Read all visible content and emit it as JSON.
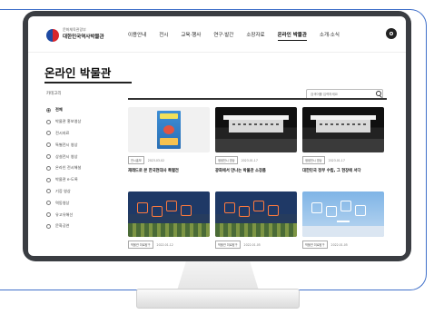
{
  "header": {
    "logo_top": "문화체육관광부",
    "logo_name": "대한민국역사박물관",
    "nav": [
      "이용안내",
      "전시",
      "교육·행사",
      "연구·발간",
      "소장자료",
      "온라인 박물관",
      "소개·소식"
    ],
    "active_nav_index": 5
  },
  "sidebar": {
    "page_title": "온라인 박물관",
    "category": "카테고리",
    "items": [
      "전체",
      "박물관 홍보영상",
      "전시자료",
      "특별전시 영상",
      "상설전시 영상",
      "온라인 전시해설",
      "박물관 e-도록",
      "기증 영상",
      "역동영상",
      "유고유해선",
      "문화공연"
    ],
    "selected_index": 0
  },
  "search": {
    "placeholder": "검색어를 입력하세요"
  },
  "cards": [
    {
      "badge": "전시홍보",
      "date": "2023.03.02",
      "title": "재래드로 본 한국현대사 특별전",
      "thumb": "poster"
    },
    {
      "badge": "생생전시 영상",
      "date": "2023.01.17",
      "title": "광화에서 만나는 박물관 소장품",
      "thumb": "building"
    },
    {
      "badge": "생생전시 영상",
      "date": "2023.01.17",
      "title": "대한민국 정부 수립, 그 현장에 서다",
      "thumb": "building"
    },
    {
      "badge": "박물관 미로탐구",
      "date": "2022.01.12",
      "title": "",
      "thumb": "neon-night"
    },
    {
      "badge": "박물관 미로탐구",
      "date": "2022.01.05",
      "title": "",
      "thumb": "neon-night"
    },
    {
      "badge": "박물관 미로탐구",
      "date": "2022.01.05",
      "title": "",
      "thumb": "neon-sky"
    }
  ],
  "colors": {
    "frame_line": "#3f6fc9",
    "monitor_bezel": "#3a3d42",
    "accent": "#111111"
  }
}
